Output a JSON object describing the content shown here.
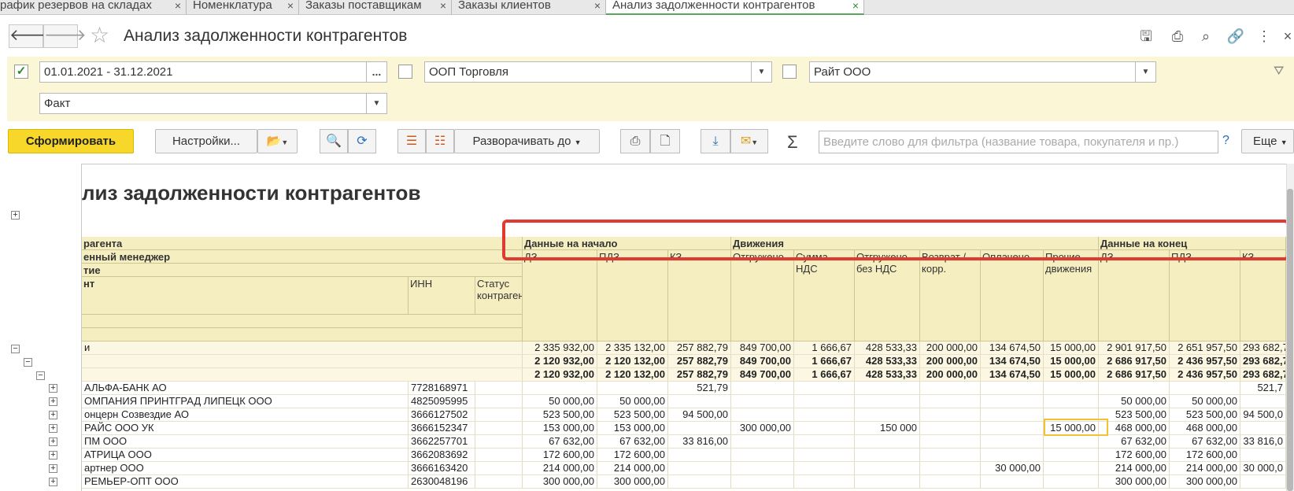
{
  "tabs": [
    {
      "label": "рафик резервов на складах",
      "close": "×"
    },
    {
      "label": "Номенклатура",
      "close": "×"
    },
    {
      "label": "Заказы поставщикам",
      "close": "×"
    },
    {
      "label": "Заказы клиентов",
      "close": "×"
    },
    {
      "label": "Анализ задолженности контрагентов",
      "close": "×"
    }
  ],
  "window": {
    "title": "Анализ задолженности контрагентов",
    "close": "×"
  },
  "filters": {
    "period_value": "01.01.2021 - 31.12.2021",
    "period_button": "...",
    "org_value": "ООП Торговля",
    "counterparty_value": "Райт ООО",
    "scenario_value": "Факт"
  },
  "toolbar": {
    "generate_label": "Сформировать",
    "settings_label": "Настройки...",
    "expand_label": "Разворачивать до",
    "search_placeholder": "Введите слово для фильтра (название товара, покупателя и пр.)",
    "help_label": "?",
    "more_label": "Еще",
    "sigma": "Σ"
  },
  "report": {
    "title": "лиз задолженности контрагентов",
    "header": {
      "row1": "рагента",
      "row2": "енный менеджер",
      "row3": "тие",
      "row4": "нт",
      "inn": "ИНН",
      "status": "Статус контрагента",
      "group_start": "Данные на начало",
      "group_moves": "Движения",
      "group_end": "Данные на конец",
      "cols": [
        "ДЗ",
        "ПДЗ",
        "КЗ",
        "Отгружено",
        "Сумма НДС",
        "Отгружено без НДС",
        "Возврат / корр.",
        "Оплачено",
        "Прочие движения",
        "ДЗ",
        "ПДЗ",
        "КЗ"
      ]
    },
    "totals": [
      {
        "label": "и",
        "values": [
          "2 335 932,00",
          "2 335 132,00",
          "257 882,79",
          "849 700,00",
          "1 666,67",
          "428 533,33",
          "200 000,00",
          "134 674,50",
          "15 000,00",
          "2 901 917,50",
          "2 651 957,50",
          "293 682,7"
        ]
      },
      {
        "label": "",
        "values": [
          "2 120 932,00",
          "2 120 132,00",
          "257 882,79",
          "849 700,00",
          "1 666,67",
          "428 533,33",
          "200 000,00",
          "134 674,50",
          "15 000,00",
          "2 686 917,50",
          "2 436 957,50",
          "293 682,7"
        ]
      },
      {
        "label": "",
        "values": [
          "2 120 932,00",
          "2 120 132,00",
          "257 882,79",
          "849 700,00",
          "1 666,67",
          "428 533,33",
          "200 000,00",
          "134 674,50",
          "15 000,00",
          "2 686 917,50",
          "2 436 957,50",
          "293 682,7"
        ]
      }
    ],
    "rows": [
      {
        "name": "АЛЬФА-БАНК АО",
        "inn": "7728168971",
        "values": [
          "",
          "",
          "521,79",
          "",
          "",
          "",
          "",
          "",
          "",
          "",
          "",
          "521,7"
        ]
      },
      {
        "name": "ОМПАНИЯ ПРИНТГРАД ЛИПЕЦК ООО",
        "inn": "4825095995",
        "values": [
          "50 000,00",
          "50 000,00",
          "",
          "",
          "",
          "",
          "",
          "",
          "",
          "50 000,00",
          "50 000,00",
          ""
        ]
      },
      {
        "name": "онцерн Созвездие АО",
        "inn": "3666127502",
        "values": [
          "523 500,00",
          "523 500,00",
          "94 500,00",
          "",
          "",
          "",
          "",
          "",
          "",
          "523 500,00",
          "523 500,00",
          "94 500,0"
        ]
      },
      {
        "name": "РАЙС ООО УК",
        "inn": "3666152347",
        "values": [
          "153 000,00",
          "153 000,00",
          "",
          "300 000,00",
          "",
          "150 000",
          "",
          "",
          "15 000,00",
          "468 000,00",
          "468 000,00",
          ""
        ]
      },
      {
        "name": "ПМ ООО",
        "inn": "3662257701",
        "values": [
          "67 632,00",
          "67 632,00",
          "33 816,00",
          "",
          "",
          "",
          "",
          "",
          "",
          "67 632,00",
          "67 632,00",
          "33 816,0"
        ]
      },
      {
        "name": "АТРИЦА ООО",
        "inn": "3662083692",
        "values": [
          "172 600,00",
          "172 600,00",
          "",
          "",
          "",
          "",
          "",
          "",
          "",
          "172 600,00",
          "172 600,00",
          ""
        ]
      },
      {
        "name": "артнер ООО",
        "inn": "3666163420",
        "values": [
          "214 000,00",
          "214 000,00",
          "",
          "",
          "",
          "",
          "",
          "30 000,00",
          "",
          "214 000,00",
          "214 000,00",
          "30 000,0"
        ]
      },
      {
        "name": "РЕМЬЕР-ОПТ ООО",
        "inn": "2630048196",
        "values": [
          "300 000,00",
          "300 000,00",
          "",
          "",
          "",
          "",
          "",
          "",
          "",
          "300 000,00",
          "300 000,00",
          ""
        ]
      }
    ]
  },
  "colors": {
    "accent_yellow": "#f7d82a",
    "highlight_red": "#e03b32",
    "highlight_yellow": "#f3c232",
    "header_fill": "#f5eec0"
  }
}
